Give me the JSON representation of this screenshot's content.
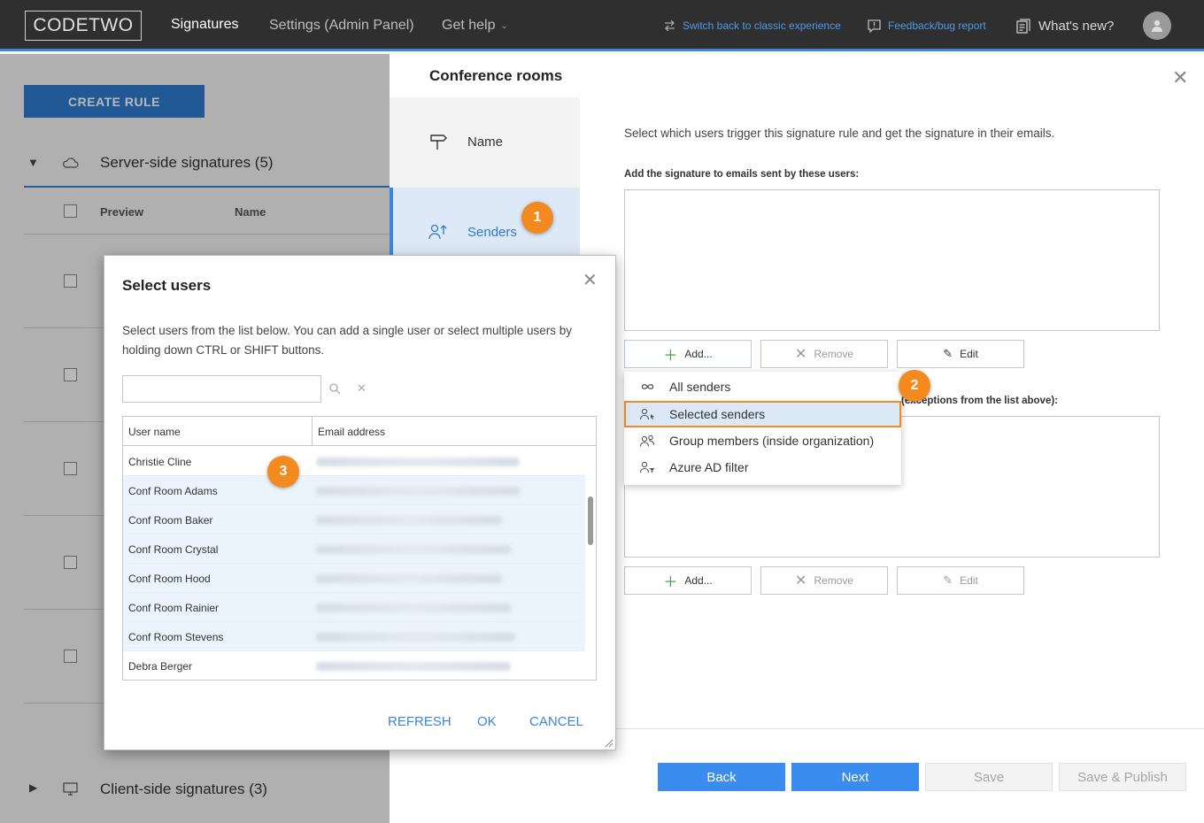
{
  "topbar": {
    "logo": "CODETWO",
    "nav": [
      "Signatures",
      "Settings (Admin Panel)",
      "Get help"
    ],
    "switch_link": "Switch back to classic experience",
    "feedback_link": "Feedback/bug report",
    "whats_new": "What's new?"
  },
  "background": {
    "create_rule": "CREATE RULE",
    "server_side": "Server-side signatures (5)",
    "client_side": "Client-side signatures (3)",
    "col_preview": "Preview",
    "col_name": "Name"
  },
  "panel": {
    "title": "Conference rooms",
    "steps": [
      "Name",
      "Senders"
    ],
    "description": "Select which users trigger this signature rule and get the signature in their emails.",
    "add_label": "Add the signature to emails sent by these users:",
    "except_label": "(exceptions from the list above):",
    "buttons": {
      "add": "Add...",
      "remove": "Remove",
      "edit": "Edit"
    },
    "footer": {
      "back": "Back",
      "next": "Next",
      "save": "Save",
      "save_publish": "Save & Publish"
    }
  },
  "dropdown": {
    "items": [
      "All senders",
      "Selected senders",
      "Group members (inside organization)",
      "Azure AD filter"
    ],
    "highlighted": "Selected senders"
  },
  "markers": [
    "1",
    "2",
    "3"
  ],
  "dialog": {
    "title": "Select users",
    "description": "Select users from the list below. You can add a single user or select multiple users by holding down CTRL or SHIFT buttons.",
    "search_value": "",
    "columns": [
      "User name",
      "Email address"
    ],
    "rows": [
      {
        "name": "Christie Cline",
        "selected": false
      },
      {
        "name": "Conf Room Adams",
        "selected": true
      },
      {
        "name": "Conf Room Baker",
        "selected": true
      },
      {
        "name": "Conf Room Crystal",
        "selected": true
      },
      {
        "name": "Conf Room Hood",
        "selected": true
      },
      {
        "name": "Conf Room Rainier",
        "selected": true
      },
      {
        "name": "Conf Room Stevens",
        "selected": true
      },
      {
        "name": "Debra Berger",
        "selected": false
      }
    ],
    "actions": {
      "refresh": "REFRESH",
      "ok": "OK",
      "cancel": "CANCEL"
    }
  },
  "colors": {
    "accent": "#3b86d6",
    "marker": "#f28a1f",
    "topbar": "#2f2f2f"
  }
}
